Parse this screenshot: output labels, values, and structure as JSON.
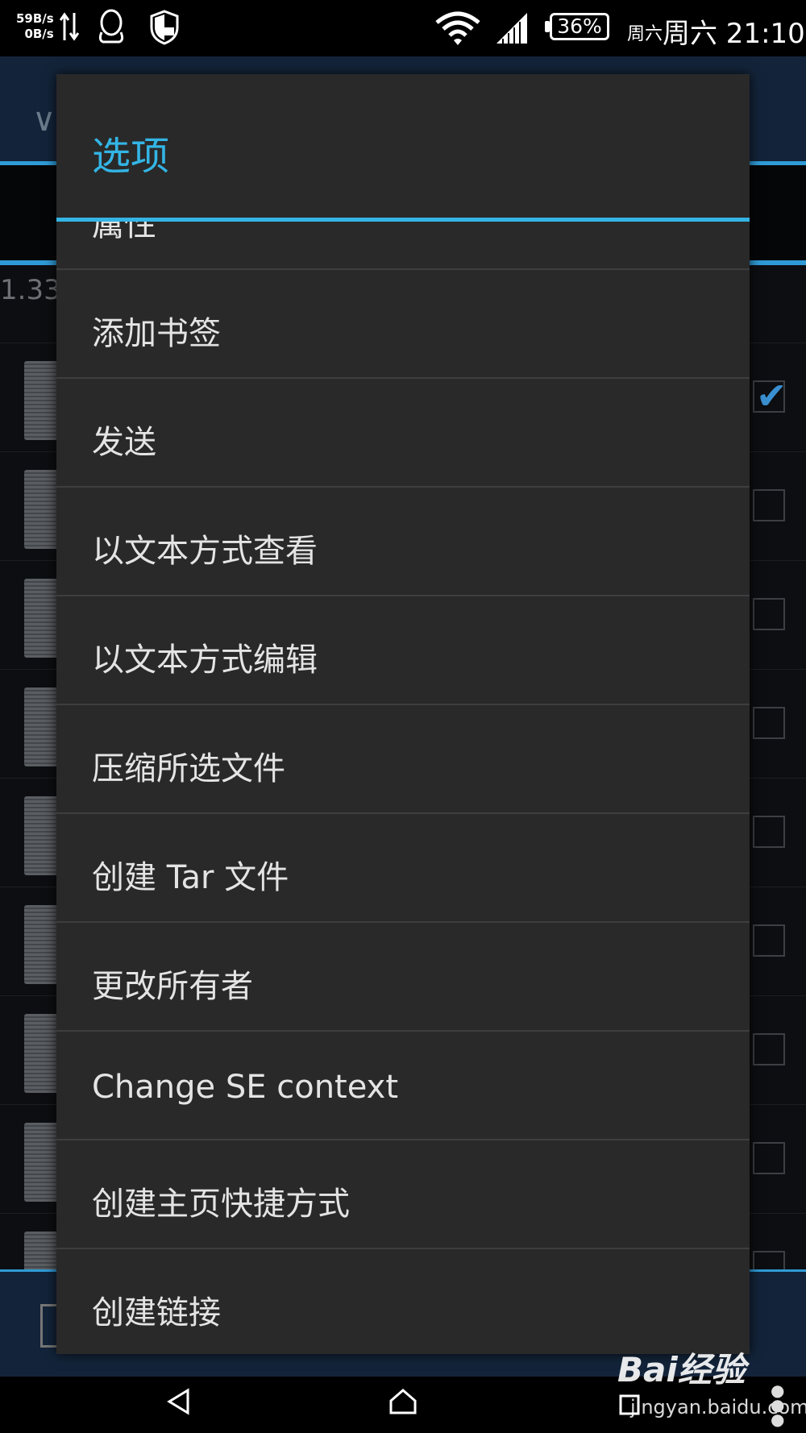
{
  "status_bar": {
    "net_up": "59B/s",
    "net_down": "0B/s",
    "battery": "36%",
    "day_small": "周六",
    "time": "周六 21:10"
  },
  "background": {
    "path_prefix": "1.33"
  },
  "dialog": {
    "title": "选项",
    "items": [
      {
        "label": "属性"
      },
      {
        "label": "添加书签"
      },
      {
        "label": "发送"
      },
      {
        "label": "以文本方式查看"
      },
      {
        "label": "以文本方式编辑"
      },
      {
        "label": "压缩所选文件"
      },
      {
        "label": "创建 Tar 文件"
      },
      {
        "label": "更改所有者"
      },
      {
        "label": "Change SE context"
      },
      {
        "label": "创建主页快捷方式"
      },
      {
        "label": "创建链接"
      }
    ]
  },
  "watermark": {
    "logo": "Bai经验",
    "url": "jingyan.baidu.com"
  },
  "colors": {
    "accent": "#33b5e5",
    "dialog_bg": "#292929"
  }
}
